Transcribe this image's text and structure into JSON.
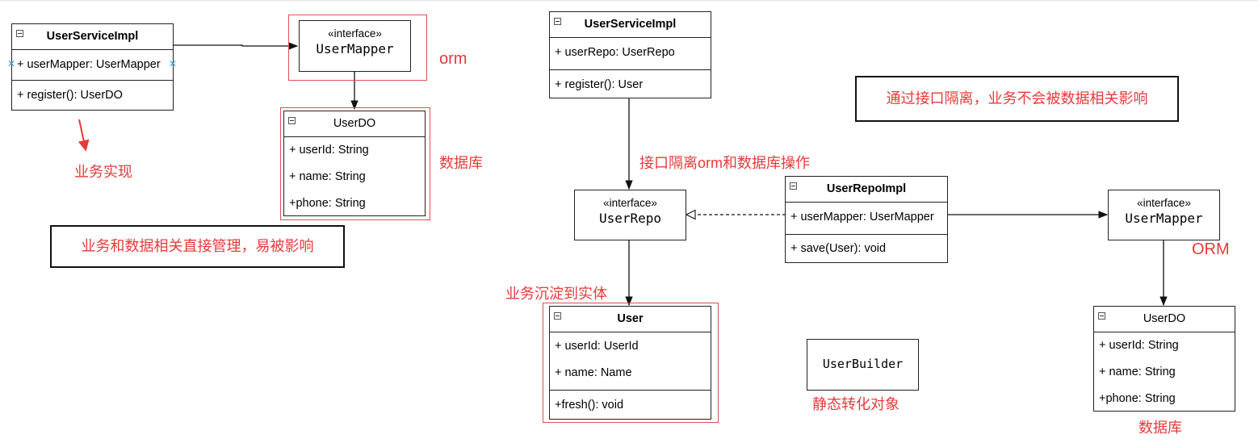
{
  "left": {
    "service": {
      "name": "UserServiceImpl",
      "attrs": [
        "+ userMapper: UserMapper"
      ],
      "ops": [
        "+ register(): UserDO"
      ]
    },
    "mapper": {
      "stereotype": "«interface»",
      "name": "UserMapper"
    },
    "userdo": {
      "name": "UserDO",
      "attrs": [
        "+ userId: String",
        "+ name: String",
        "+phone: String"
      ]
    },
    "labels": {
      "orm": "orm",
      "db": "数据库",
      "biz_impl": "业务实现"
    },
    "note": "业务和数据相关直接管理，易被影响"
  },
  "right": {
    "service": {
      "name": "UserServiceImpl",
      "attrs": [
        "+ userRepo: UserRepo"
      ],
      "ops": [
        "+ register(): User"
      ]
    },
    "repo": {
      "stereotype": "«interface»",
      "name": "UserRepo"
    },
    "repo_impl": {
      "name": "UserRepoImpl",
      "attrs": [
        "+ userMapper: UserMapper"
      ],
      "ops": [
        "+ save(User): void"
      ]
    },
    "mapper": {
      "stereotype": "«interface»",
      "name": "UserMapper"
    },
    "user": {
      "name": "User",
      "attrs": [
        "+ userId: UserId",
        "+ name: Name"
      ],
      "ops": [
        "+fresh(): void"
      ]
    },
    "userdo": {
      "name": "UserDO",
      "attrs": [
        "+ userId: String",
        "+ name: String",
        "+phone: String"
      ]
    },
    "builder": {
      "name": "UserBuilder"
    },
    "labels": {
      "isolation": "接口隔离orm和数据库操作",
      "entity": "业务沉淀到实体",
      "orm": "ORM",
      "db": "数据库",
      "builder": "静态转化对象"
    },
    "note": "通过接口隔离，业务不会被数据相关影响"
  },
  "colors": {
    "accent_red": "#e83a3a",
    "line": "#222222",
    "marker_blue": "#3aa3d6"
  }
}
